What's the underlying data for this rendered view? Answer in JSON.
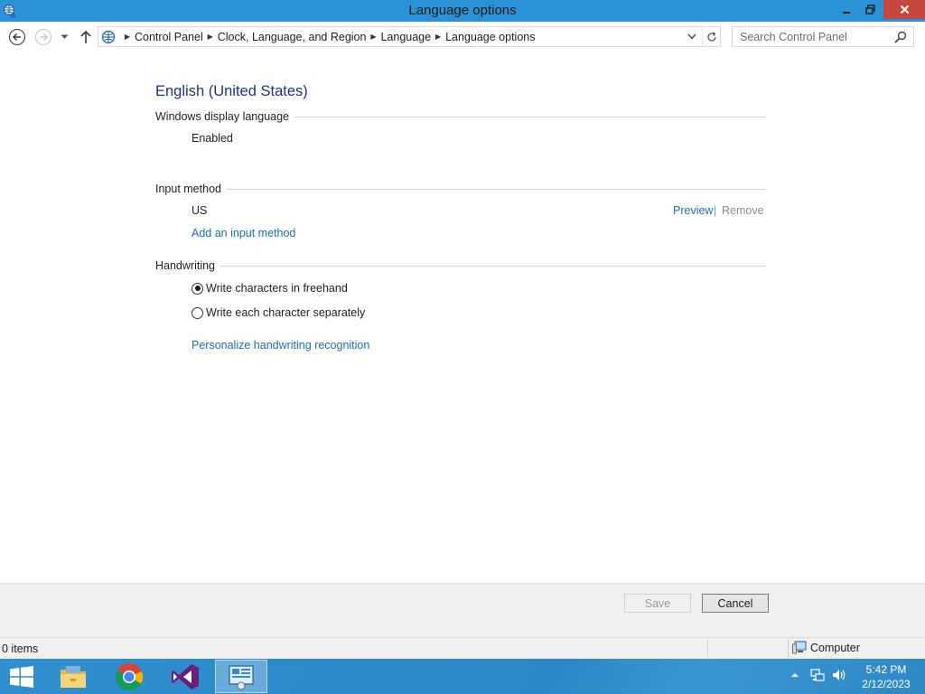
{
  "window": {
    "title": "Language options"
  },
  "address_bar": {
    "breadcrumbs": [
      "Control Panel",
      "Clock, Language, and Region",
      "Language",
      "Language options"
    ]
  },
  "search": {
    "placeholder": "Search Control Panel"
  },
  "content": {
    "language_title": "English (United States)",
    "display_section": {
      "label": "Windows display language",
      "status": "Enabled"
    },
    "input_section": {
      "label": "Input method",
      "method": "US",
      "preview_link": "Preview",
      "separator": "|",
      "remove_link": "Remove",
      "add_link": "Add an input method"
    },
    "handwriting_section": {
      "label": "Handwriting",
      "options": [
        {
          "label": "Write characters in freehand",
          "selected": true
        },
        {
          "label": "Write each character separately",
          "selected": false
        }
      ],
      "personalize_link": "Personalize handwriting recognition"
    }
  },
  "buttons": {
    "save": "Save",
    "cancel": "Cancel"
  },
  "status_bar": {
    "items": "0 items",
    "location": "Computer"
  },
  "taskbar": {
    "apps": [
      "file-explorer-icon",
      "chrome-icon",
      "visual-studio-icon",
      "control-panel-icon"
    ],
    "time": "5:42 PM",
    "date": "2/12/2023"
  },
  "colors": {
    "titlebar": "#2b92d8",
    "link": "#1a6fb4",
    "heading": "#1e3287",
    "close_button": "#c7463b",
    "taskbar": "#2c87c6"
  }
}
